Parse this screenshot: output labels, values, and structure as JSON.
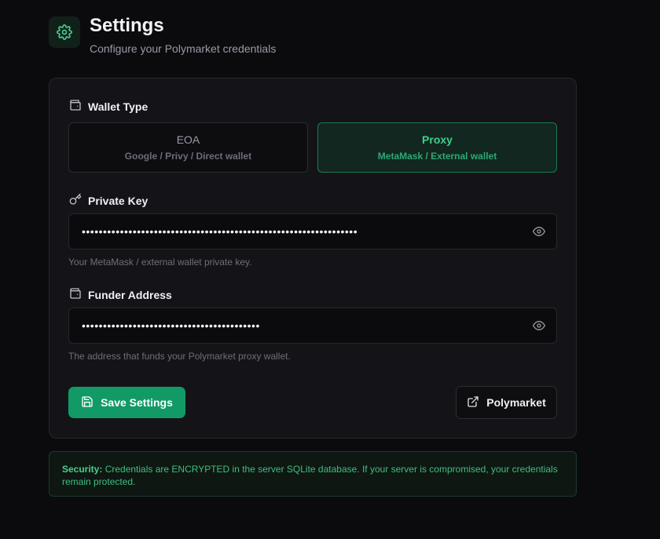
{
  "header": {
    "title": "Settings",
    "subtitle": "Configure your Polymarket credentials",
    "icon": "gear-icon"
  },
  "wallet_type": {
    "label": "Wallet Type",
    "icon": "wallet-icon",
    "options": [
      {
        "title": "EOA",
        "subtitle": "Google / Privy / Direct wallet",
        "selected": false
      },
      {
        "title": "Proxy",
        "subtitle": "MetaMask / External wallet",
        "selected": true
      }
    ]
  },
  "private_key": {
    "label": "Private Key",
    "icon": "key-icon",
    "masked_value": "•••••••••••••••••••••••••••••••••••••••••••••••••••••••••••••••••",
    "hint": "Your MetaMask / external wallet private key.",
    "toggle_icon": "eye-icon"
  },
  "funder_address": {
    "label": "Funder Address",
    "icon": "wallet-icon",
    "masked_value": "••••••••••••••••••••••••••••••••••••••••••",
    "hint": "The address that funds your Polymarket proxy wallet.",
    "toggle_icon": "eye-icon"
  },
  "actions": {
    "save_label": "Save Settings",
    "save_icon": "save-icon",
    "external_label": "Polymarket",
    "external_icon": "external-link-icon"
  },
  "security_notice": {
    "label": "Security:",
    "text": " Credentials are ENCRYPTED in the server SQLite database. If your server is compromised, your credentials remain protected."
  },
  "colors": {
    "background": "#0b0b0e",
    "accent": "#129a66",
    "accent_text": "#3fcf8e",
    "card": "#141418"
  }
}
